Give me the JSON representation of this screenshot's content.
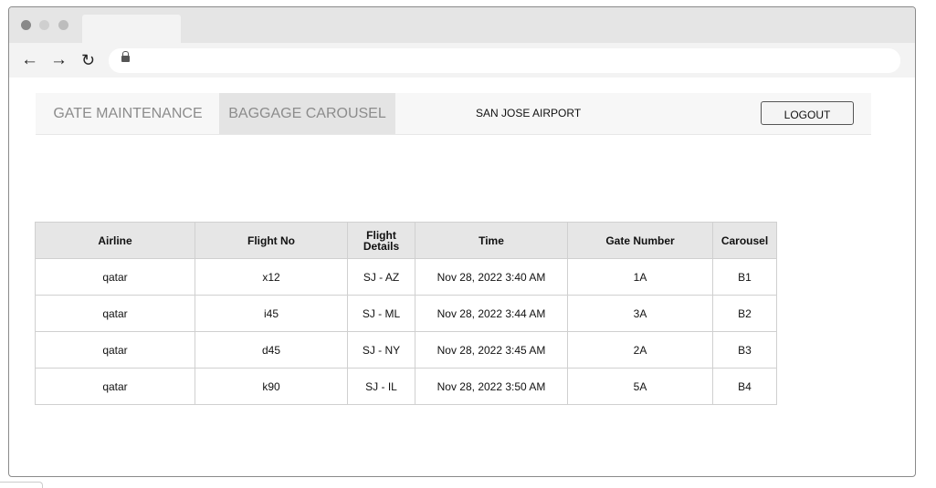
{
  "nav": {
    "tabs": [
      {
        "label": "GATE MAINTENANCE"
      },
      {
        "label": "BAGGAGE CAROUSEL"
      }
    ],
    "airport_name": "SAN JOSE AIRPORT",
    "logout_label": "LOGOUT"
  },
  "table": {
    "headers": [
      "Airline",
      "Flight No",
      "Flight Details",
      "Time",
      "Gate Number",
      "Carousel"
    ],
    "rows": [
      [
        "qatar",
        "x12",
        "SJ - AZ",
        "Nov 28, 2022 3:40 AM",
        "1A",
        "B1"
      ],
      [
        "qatar",
        "i45",
        "SJ - ML",
        "Nov 28, 2022 3:44 AM",
        "3A",
        "B2"
      ],
      [
        "qatar",
        "d45",
        "SJ - NY",
        "Nov 28, 2022 3:45 AM",
        "2A",
        "B3"
      ],
      [
        "qatar",
        "k90",
        "SJ - IL",
        "Nov 28, 2022 3:50 AM",
        "5A",
        "B4"
      ]
    ]
  },
  "icons": {
    "back": "←",
    "forward": "→",
    "reload": "↻"
  }
}
